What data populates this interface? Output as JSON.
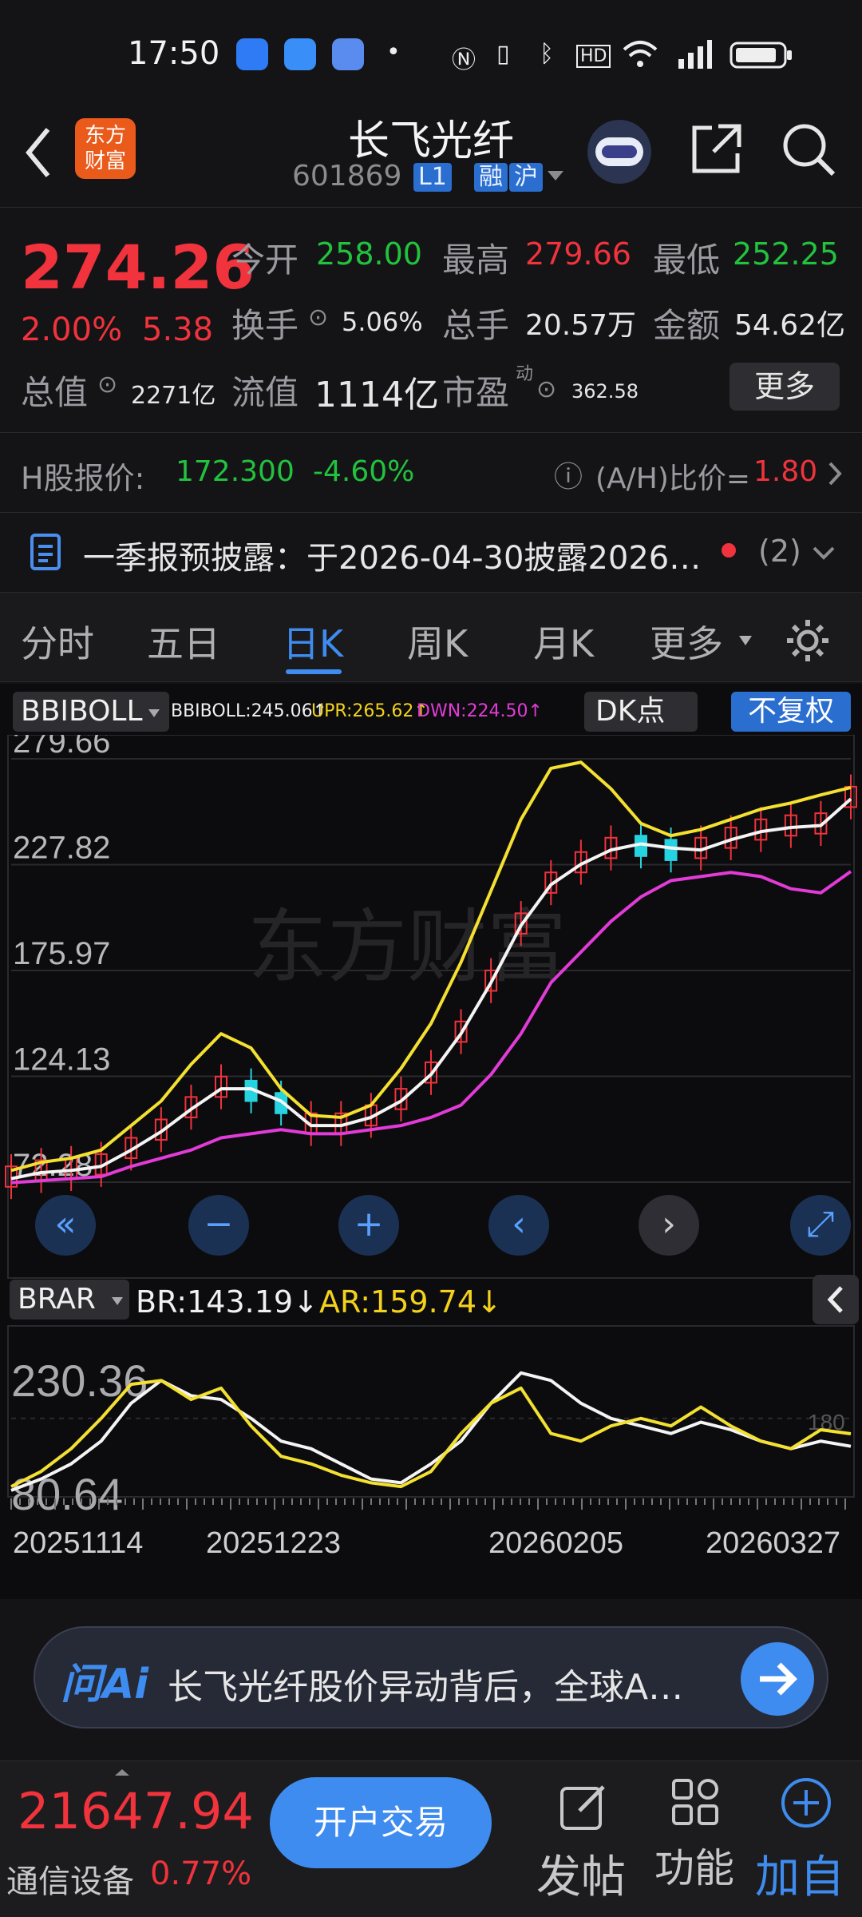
{
  "status_bar": {
    "time": "17:50"
  },
  "header": {
    "title": "长飞光纤",
    "code": "601869",
    "tags": [
      "L1",
      "融",
      "沪"
    ]
  },
  "quote": {
    "price": "274.26",
    "change_pct": "2.00%",
    "change": "5.38",
    "open_label": "今开",
    "open": "258.00",
    "high_label": "最高",
    "high": "279.66",
    "low_label": "最低",
    "low": "252.25",
    "turnover_label": "换手",
    "turnover": "5.06%",
    "volume_label": "总手",
    "volume": "20.57万",
    "amount_label": "金额",
    "amount": "54.62亿",
    "mcap_label": "总值",
    "mcap": "2271亿",
    "float_label": "流值",
    "float": "1114亿",
    "pe_label": "市盈",
    "pe_super": "动",
    "pe": "362.58",
    "more_label": "更多"
  },
  "h_share": {
    "label": "H股报价:",
    "price": "172.300",
    "pct": "-4.60%",
    "ratio_label": "(A/H)比价=",
    "ratio": "1.80"
  },
  "notice": {
    "text": "一季报预披露：于2026-04-30披露2026…",
    "count": "(2)"
  },
  "tabs": {
    "items": [
      "分时",
      "五日",
      "日K",
      "周K",
      "月K",
      "更多"
    ],
    "active": "日K"
  },
  "indicator_main": {
    "name": "BBIBOLL",
    "bbiboll": "BBIBOLL:245.06↑",
    "upr": "UPR:265.62↑",
    "dwn": "DWN:224.50↑",
    "dk_label": "DK点",
    "adjust_label": "不复权"
  },
  "indicator_sub": {
    "name": "BRAR",
    "br": "BR:143.19↓",
    "ar": "AR:159.74↓",
    "ref_level": "180"
  },
  "watermark": "东方财富",
  "ai_bar": {
    "logo": "问Ai",
    "text": "长飞光纤股价异动背后，全球A…"
  },
  "footer": {
    "index_value": "21647.94",
    "index_name": "通信设备",
    "index_pct": "0.77%",
    "trade_label": "开户交易",
    "post_label": "发帖",
    "func_label": "功能",
    "add_label": "加自"
  },
  "chart_data": [
    {
      "type": "line",
      "title": "BBIBOLL",
      "y_ticks": [
        "279.66",
        "227.82",
        "175.97",
        "124.13",
        "72.28"
      ],
      "x_ticks": [
        "20251114",
        "20251223",
        "20260205",
        "20260327"
      ],
      "ylim": [
        72.28,
        279.66
      ],
      "series": [
        {
          "name": "UPR",
          "color": "#f4e030",
          "values": [
            78,
            82,
            84,
            88,
            100,
            112,
            130,
            145,
            138,
            118,
            105,
            104,
            110,
            128,
            150,
            180,
            215,
            250,
            275,
            278,
            265,
            248,
            242,
            245,
            250,
            255,
            258,
            262,
            265.62
          ]
        },
        {
          "name": "BBIBOLL",
          "color": "#f4f4f4",
          "values": [
            74,
            77,
            78,
            80,
            88,
            97,
            108,
            118,
            118,
            112,
            100,
            100,
            104,
            112,
            125,
            145,
            170,
            198,
            218,
            228,
            235,
            238,
            236,
            235,
            240,
            244,
            246,
            247,
            260
          ]
        },
        {
          "name": "DWN",
          "color": "#e23bd7",
          "values": [
            72,
            73,
            74,
            75,
            80,
            84,
            88,
            94,
            96,
            98,
            96,
            96,
            98,
            100,
            104,
            110,
            125,
            145,
            170,
            185,
            200,
            212,
            220,
            222,
            224,
            222,
            216,
            214,
            224.5
          ]
        }
      ]
    },
    {
      "type": "line",
      "title": "BRAR",
      "y_ticks": [
        "230.36",
        "80.64"
      ],
      "ylim": [
        80.64,
        230.36
      ],
      "ref_line": 180,
      "series": [
        {
          "name": "BR",
          "color": "#f4f4f4",
          "values": [
            85,
            100,
            120,
            150,
            200,
            230,
            210,
            205,
            180,
            150,
            140,
            120,
            100,
            95,
            120,
            150,
            200,
            240,
            230,
            200,
            180,
            170,
            160,
            175,
            165,
            150,
            140,
            150,
            143.19
          ]
        },
        {
          "name": "AR",
          "color": "#f4e030",
          "values": [
            90,
            110,
            140,
            180,
            225,
            230,
            205,
            220,
            170,
            130,
            120,
            105,
            95,
            90,
            110,
            160,
            200,
            220,
            160,
            150,
            170,
            180,
            170,
            195,
            170,
            150,
            140,
            165,
            159.74
          ]
        }
      ]
    }
  ]
}
